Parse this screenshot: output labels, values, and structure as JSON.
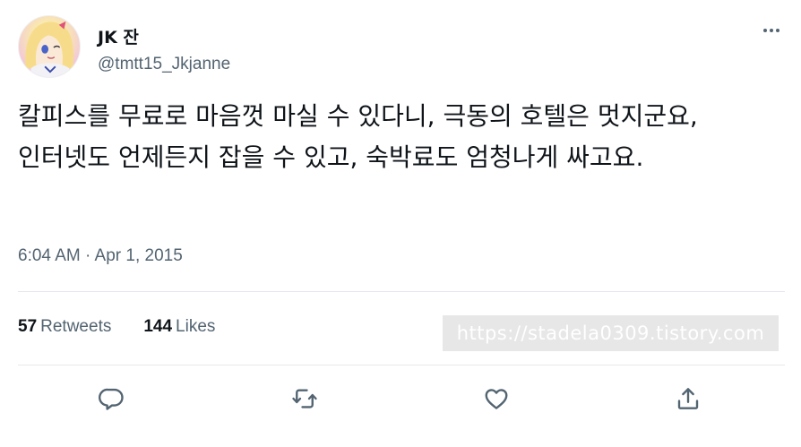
{
  "author": {
    "name": "JK 잔",
    "handle": "@tmtt15_Jkjanne"
  },
  "tweet": {
    "text": "칼피스를 무료로 마음껏 마실 수 있다니, 극동의 호텔은 멋지군요, 인터넷도 언제든지 잡을 수 있고, 숙박료도 엄청나게 싸고요.",
    "timestamp": "6:04 AM · Apr 1, 2015"
  },
  "stats": {
    "retweets_count": "57",
    "retweets_label": "Retweets",
    "likes_count": "144",
    "likes_label": "Likes"
  },
  "watermark": "https://stadela0309.tistory.com",
  "icons": {
    "more": "more-dots-icon",
    "reply": "reply-icon",
    "retweet": "retweet-icon",
    "like": "heart-icon",
    "share": "share-icon"
  },
  "colors": {
    "text": "#0f1419",
    "secondary": "#536471",
    "divider": "#e3e8ec",
    "watermark_bg": "#e7e7e7"
  }
}
